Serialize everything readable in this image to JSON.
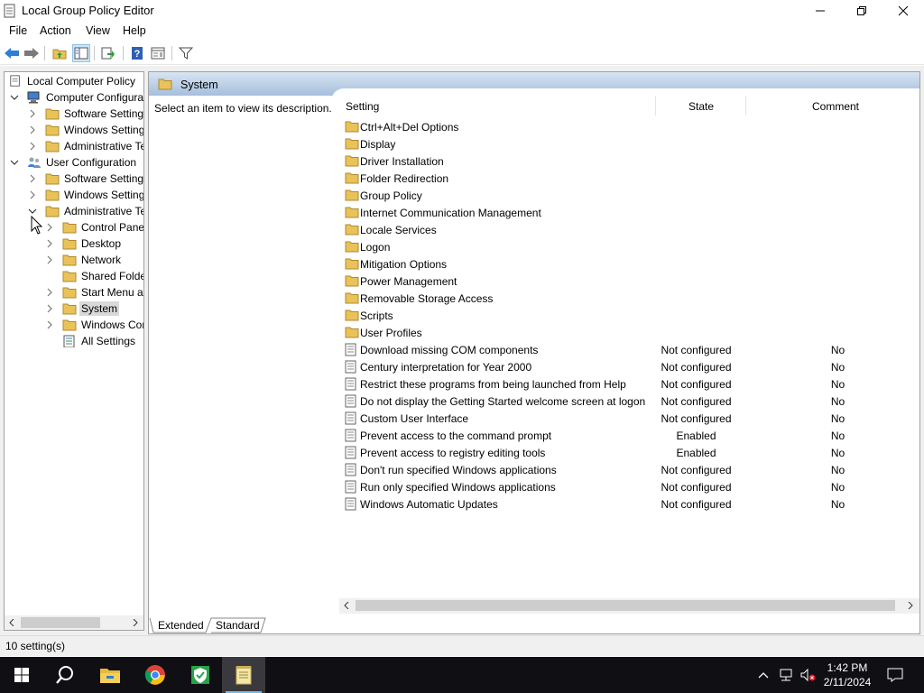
{
  "window": {
    "title": "Local Group Policy Editor"
  },
  "menu": [
    "File",
    "Action",
    "View",
    "Help"
  ],
  "tree": {
    "root": "Local Computer Policy",
    "items": [
      {
        "label": "Computer Configura",
        "level": 1,
        "expander": "expanded",
        "icon": "computer-icon"
      },
      {
        "label": "Software Settings",
        "level": 2,
        "expander": "collapsed",
        "icon": "folder-icon"
      },
      {
        "label": "Windows Setting",
        "level": 2,
        "expander": "collapsed",
        "icon": "folder-icon"
      },
      {
        "label": "Administrative Te",
        "level": 2,
        "expander": "collapsed",
        "icon": "folder-icon"
      },
      {
        "label": "User Configuration",
        "level": 1,
        "expander": "expanded",
        "icon": "users-icon"
      },
      {
        "label": "Software Settings",
        "level": 2,
        "expander": "collapsed",
        "icon": "folder-icon"
      },
      {
        "label": "Windows Setting",
        "level": 2,
        "expander": "collapsed",
        "icon": "folder-icon"
      },
      {
        "label": "Administrative Te",
        "level": 2,
        "expander": "expanded",
        "icon": "folder-icon"
      },
      {
        "label": "Control Panel",
        "level": 3,
        "expander": "collapsed",
        "icon": "folder-icon"
      },
      {
        "label": "Desktop",
        "level": 3,
        "expander": "collapsed",
        "icon": "folder-icon"
      },
      {
        "label": "Network",
        "level": 3,
        "expander": "collapsed",
        "icon": "folder-icon"
      },
      {
        "label": "Shared Folder",
        "level": 3,
        "expander": "none",
        "icon": "folder-icon"
      },
      {
        "label": "Start Menu ar",
        "level": 3,
        "expander": "collapsed",
        "icon": "folder-icon"
      },
      {
        "label": "System",
        "level": 3,
        "expander": "collapsed",
        "icon": "folder-icon",
        "selected": true
      },
      {
        "label": "Windows Cor",
        "level": 3,
        "expander": "collapsed",
        "icon": "folder-icon"
      },
      {
        "label": "All Settings",
        "level": 3,
        "expander": "none",
        "icon": "all-settings-icon"
      }
    ]
  },
  "details": {
    "header": "System",
    "description": "Select an item to view its description.",
    "columns": [
      "Setting",
      "State",
      "Comment"
    ],
    "folders": [
      "Ctrl+Alt+Del Options",
      "Display",
      "Driver Installation",
      "Folder Redirection",
      "Group Policy",
      "Internet Communication Management",
      "Locale Services",
      "Logon",
      "Mitigation Options",
      "Power Management",
      "Removable Storage Access",
      "Scripts",
      "User Profiles"
    ],
    "settings": [
      {
        "name": "Download missing COM components",
        "state": "Not configured",
        "comment": "No"
      },
      {
        "name": "Century interpretation for Year 2000",
        "state": "Not configured",
        "comment": "No"
      },
      {
        "name": "Restrict these programs from being launched from Help",
        "state": "Not configured",
        "comment": "No"
      },
      {
        "name": "Do not display the Getting Started welcome screen at logon",
        "state": "Not configured",
        "comment": "No"
      },
      {
        "name": "Custom User Interface",
        "state": "Not configured",
        "comment": "No"
      },
      {
        "name": "Prevent access to the command prompt",
        "state": "Enabled",
        "comment": "No"
      },
      {
        "name": "Prevent access to registry editing tools",
        "state": "Enabled",
        "comment": "No"
      },
      {
        "name": "Don't run specified Windows applications",
        "state": "Not configured",
        "comment": "No"
      },
      {
        "name": "Run only specified Windows applications",
        "state": "Not configured",
        "comment": "No"
      },
      {
        "name": "Windows Automatic Updates",
        "state": "Not configured",
        "comment": "No"
      }
    ],
    "tabs": [
      "Extended",
      "Standard"
    ]
  },
  "status": "10 setting(s)",
  "taskbar": {
    "time": "1:42 PM",
    "date": "2/11/2024"
  }
}
